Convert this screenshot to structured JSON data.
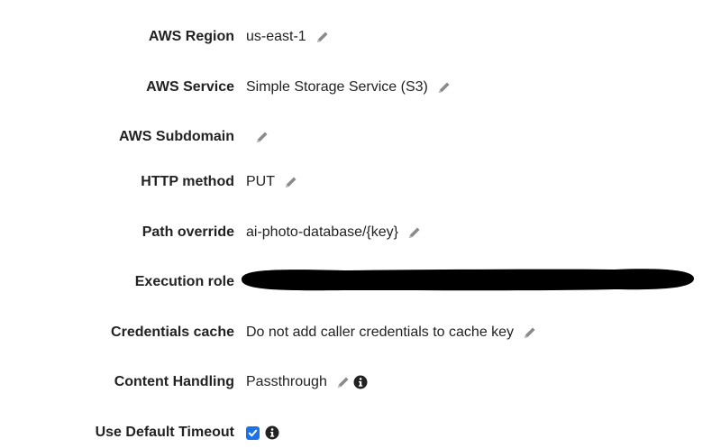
{
  "rows": [
    {
      "label": "AWS Region",
      "value": "us-east-1",
      "edit_icon": "pencil-icon"
    },
    {
      "label": "AWS Service",
      "value": "Simple Storage Service (S3)",
      "edit_icon": "pencil-icon"
    },
    {
      "label": "AWS Subdomain",
      "value": "",
      "edit_icon": "pencil-icon"
    },
    {
      "label": "HTTP method",
      "value": "PUT",
      "edit_icon": "pencil-icon"
    },
    {
      "label": "Path override",
      "value": "ai-photo-database/{key}",
      "edit_icon": "pencil-icon"
    },
    {
      "label": "Execution role",
      "value": "",
      "redacted": true
    },
    {
      "label": "Credentials cache",
      "value": "Do not add caller credentials to cache key",
      "edit_icon": "pencil-icon"
    },
    {
      "label": "Content Handling",
      "value": "Passthrough",
      "edit_icon": "pencil-icon",
      "info_icon": "info-icon"
    },
    {
      "label": "Use Default Timeout",
      "checked": true,
      "info_icon": "info-icon"
    }
  ],
  "colors": {
    "label": "#222222",
    "icon": "#8a8a8a",
    "info_icon": "#222222",
    "checkbox": "#1a73e8",
    "redaction": "#000000"
  }
}
